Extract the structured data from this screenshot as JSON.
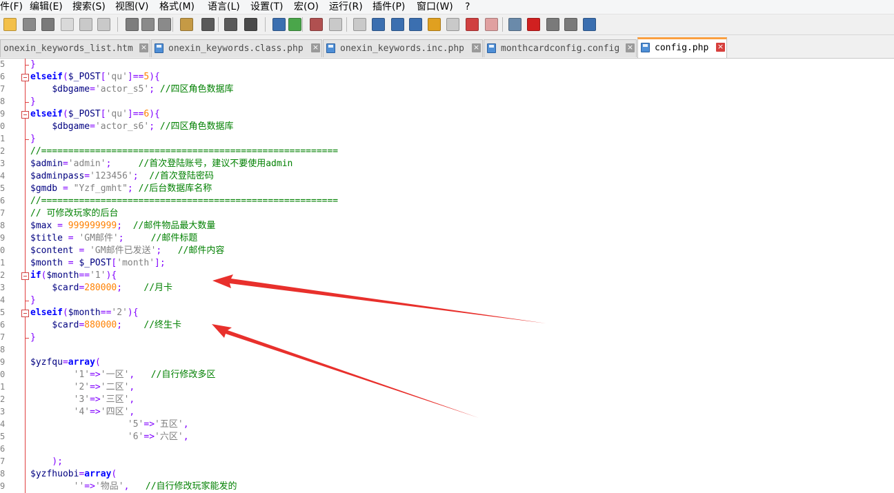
{
  "menu": [
    "件(F)",
    "编辑(E)",
    "搜索(S)",
    "视图(V)",
    "格式(M)",
    "语言(L)",
    "设置(T)",
    "宏(O)",
    "运行(R)",
    "插件(P)",
    "窗口(W)",
    "?"
  ],
  "toolbar": {
    "icons": [
      "new-file-icon",
      "open-file-icon",
      "save-icon",
      "save-all-icon",
      "close-icon",
      "close-all-icon",
      "print-icon",
      "cut-icon",
      "copy-icon",
      "paste-icon",
      "undo-icon",
      "redo-icon",
      "find-icon",
      "replace-icon",
      "zoom-in-icon",
      "zoom-out-icon",
      "sync-vertical-icon",
      "sync-horizontal-icon",
      "word-wrap-icon",
      "show-all-chars-icon",
      "indent-guide-icon",
      "user-language-icon",
      "doc-map-icon",
      "function-list-icon",
      "folder-workspace-icon",
      "monitoring-icon",
      "record-macro-icon",
      "stop-record-icon",
      "play-macro-icon",
      "run-macro-multiple-icon",
      "save-macro-icon"
    ]
  },
  "tabs": [
    {
      "label": "onexin_keywords_list.htm",
      "active": false
    },
    {
      "label": "onexin_keywords.class.php",
      "active": false
    },
    {
      "label": "onexin_keywords.inc.php",
      "active": false
    },
    {
      "label": "monthcardconfig.config",
      "active": false
    },
    {
      "label": "config.php",
      "active": true
    }
  ],
  "editor": {
    "line_numbers": [
      "5",
      "6",
      "7",
      "8",
      "9",
      "0",
      "1",
      "2",
      "3",
      "4",
      "5",
      "6",
      "7",
      "8",
      "9",
      "0",
      "1",
      "2",
      "3",
      "4",
      "5",
      "6",
      "7",
      "8",
      "9",
      "0",
      "1",
      "2",
      "3",
      "4",
      "5",
      "6",
      "7",
      "8",
      "9"
    ],
    "lines": [
      [
        {
          "t": "}",
          "c": "op"
        }
      ],
      [
        {
          "t": "elseif",
          "c": "kw"
        },
        {
          "t": "(",
          "c": "op"
        },
        {
          "t": "$_POST",
          "c": "var"
        },
        {
          "t": "[",
          "c": "op"
        },
        {
          "t": "'qu'",
          "c": "str"
        },
        {
          "t": "]==",
          "c": "op"
        },
        {
          "t": "5",
          "c": "num"
        },
        {
          "t": "){",
          "c": "op"
        }
      ],
      [
        {
          "t": "    ",
          "c": ""
        },
        {
          "t": "$dbgame",
          "c": "var"
        },
        {
          "t": "=",
          "c": "op"
        },
        {
          "t": "'actor_s5'",
          "c": "str"
        },
        {
          "t": "; ",
          "c": "op"
        },
        {
          "t": "//四区角色数据库",
          "c": "cm"
        }
      ],
      [
        {
          "t": "}",
          "c": "op"
        }
      ],
      [
        {
          "t": "elseif",
          "c": "kw"
        },
        {
          "t": "(",
          "c": "op"
        },
        {
          "t": "$_POST",
          "c": "var"
        },
        {
          "t": "[",
          "c": "op"
        },
        {
          "t": "'qu'",
          "c": "str"
        },
        {
          "t": "]==",
          "c": "op"
        },
        {
          "t": "6",
          "c": "num"
        },
        {
          "t": "){",
          "c": "op"
        }
      ],
      [
        {
          "t": "    ",
          "c": ""
        },
        {
          "t": "$dbgame",
          "c": "var"
        },
        {
          "t": "=",
          "c": "op"
        },
        {
          "t": "'actor_s6'",
          "c": "str"
        },
        {
          "t": "; ",
          "c": "op"
        },
        {
          "t": "//四区角色数据库",
          "c": "cm"
        }
      ],
      [
        {
          "t": "}",
          "c": "op"
        }
      ],
      [
        {
          "t": "//=======================================================",
          "c": "cm"
        }
      ],
      [
        {
          "t": "$admin",
          "c": "var"
        },
        {
          "t": "=",
          "c": "op"
        },
        {
          "t": "'admin'",
          "c": "str"
        },
        {
          "t": ";     ",
          "c": "op"
        },
        {
          "t": "//首次登陆账号，建议不要使用admin",
          "c": "cm"
        }
      ],
      [
        {
          "t": "$adminpass",
          "c": "var"
        },
        {
          "t": "=",
          "c": "op"
        },
        {
          "t": "'123456'",
          "c": "str"
        },
        {
          "t": ";  ",
          "c": "op"
        },
        {
          "t": "//首次登陆密码",
          "c": "cm"
        }
      ],
      [
        {
          "t": "$gmdb",
          "c": "var"
        },
        {
          "t": " = ",
          "c": "op"
        },
        {
          "t": "\"Yzf_gmht\"",
          "c": "str"
        },
        {
          "t": "; ",
          "c": "op"
        },
        {
          "t": "//后台数据库名称",
          "c": "cm"
        }
      ],
      [
        {
          "t": "//=======================================================",
          "c": "cm"
        }
      ],
      [
        {
          "t": "// 可修改玩家的后台",
          "c": "cm"
        }
      ],
      [
        {
          "t": "$max",
          "c": "var"
        },
        {
          "t": " = ",
          "c": "op"
        },
        {
          "t": "999999999",
          "c": "num"
        },
        {
          "t": ";  ",
          "c": "op"
        },
        {
          "t": "//邮件物品最大数量",
          "c": "cm"
        }
      ],
      [
        {
          "t": "$title",
          "c": "var"
        },
        {
          "t": " = ",
          "c": "op"
        },
        {
          "t": "'GM邮件'",
          "c": "str"
        },
        {
          "t": ";     ",
          "c": "op"
        },
        {
          "t": "//邮件标题",
          "c": "cm"
        }
      ],
      [
        {
          "t": "$content",
          "c": "var"
        },
        {
          "t": " = ",
          "c": "op"
        },
        {
          "t": "'GM邮件已发送'",
          "c": "str"
        },
        {
          "t": ";   ",
          "c": "op"
        },
        {
          "t": "//邮件内容",
          "c": "cm"
        }
      ],
      [
        {
          "t": "$month",
          "c": "var"
        },
        {
          "t": " = ",
          "c": "op"
        },
        {
          "t": "$_POST",
          "c": "var"
        },
        {
          "t": "[",
          "c": "op"
        },
        {
          "t": "'month'",
          "c": "str"
        },
        {
          "t": "];",
          "c": "op"
        }
      ],
      [
        {
          "t": "if",
          "c": "kw"
        },
        {
          "t": "(",
          "c": "op"
        },
        {
          "t": "$month",
          "c": "var"
        },
        {
          "t": "==",
          "c": "op"
        },
        {
          "t": "'1'",
          "c": "str"
        },
        {
          "t": "){",
          "c": "op"
        }
      ],
      [
        {
          "t": "    ",
          "c": ""
        },
        {
          "t": "$card",
          "c": "var"
        },
        {
          "t": "=",
          "c": "op"
        },
        {
          "t": "280000",
          "c": "num"
        },
        {
          "t": ";    ",
          "c": "op"
        },
        {
          "t": "//月卡",
          "c": "cm"
        }
      ],
      [
        {
          "t": "}",
          "c": "op"
        }
      ],
      [
        {
          "t": "elseif",
          "c": "kw"
        },
        {
          "t": "(",
          "c": "op"
        },
        {
          "t": "$month",
          "c": "var"
        },
        {
          "t": "==",
          "c": "op"
        },
        {
          "t": "'2'",
          "c": "str"
        },
        {
          "t": "){",
          "c": "op"
        }
      ],
      [
        {
          "t": "    ",
          "c": ""
        },
        {
          "t": "$card",
          "c": "var"
        },
        {
          "t": "=",
          "c": "op"
        },
        {
          "t": "880000",
          "c": "num"
        },
        {
          "t": ";    ",
          "c": "op"
        },
        {
          "t": "//终生卡",
          "c": "cm"
        }
      ],
      [
        {
          "t": "}",
          "c": "op"
        }
      ],
      [],
      [
        {
          "t": "$yzfqu",
          "c": "var"
        },
        {
          "t": "=",
          "c": "op"
        },
        {
          "t": "array",
          "c": "kw"
        },
        {
          "t": "(",
          "c": "op"
        }
      ],
      [
        {
          "t": "        ",
          "c": ""
        },
        {
          "t": "'1'",
          "c": "str"
        },
        {
          "t": "=>",
          "c": "op"
        },
        {
          "t": "'一区'",
          "c": "str"
        },
        {
          "t": ",   ",
          "c": "op"
        },
        {
          "t": "//自行修改多区",
          "c": "cm"
        }
      ],
      [
        {
          "t": "        ",
          "c": ""
        },
        {
          "t": "'2'",
          "c": "str"
        },
        {
          "t": "=>",
          "c": "op"
        },
        {
          "t": "'二区'",
          "c": "str"
        },
        {
          "t": ",",
          "c": "op"
        }
      ],
      [
        {
          "t": "        ",
          "c": ""
        },
        {
          "t": "'3'",
          "c": "str"
        },
        {
          "t": "=>",
          "c": "op"
        },
        {
          "t": "'三区'",
          "c": "str"
        },
        {
          "t": ",",
          "c": "op"
        }
      ],
      [
        {
          "t": "        ",
          "c": ""
        },
        {
          "t": "'4'",
          "c": "str"
        },
        {
          "t": "=>",
          "c": "op"
        },
        {
          "t": "'四区'",
          "c": "str"
        },
        {
          "t": ",",
          "c": "op"
        }
      ],
      [
        {
          "t": "                  ",
          "c": ""
        },
        {
          "t": "'5'",
          "c": "str"
        },
        {
          "t": "=>",
          "c": "op"
        },
        {
          "t": "'五区'",
          "c": "str"
        },
        {
          "t": ",",
          "c": "op"
        }
      ],
      [
        {
          "t": "                  ",
          "c": ""
        },
        {
          "t": "'6'",
          "c": "str"
        },
        {
          "t": "=>",
          "c": "op"
        },
        {
          "t": "'六区'",
          "c": "str"
        },
        {
          "t": ",",
          "c": "op"
        }
      ],
      [],
      [
        {
          "t": "    ",
          "c": ""
        },
        {
          "t": ");",
          "c": "op"
        }
      ],
      [
        {
          "t": "$yzfhuobi",
          "c": "var"
        },
        {
          "t": "=",
          "c": "op"
        },
        {
          "t": "array",
          "c": "kw"
        },
        {
          "t": "(",
          "c": "op"
        }
      ],
      [
        {
          "t": "        ",
          "c": ""
        },
        {
          "t": "''",
          "c": "str"
        },
        {
          "t": "=>",
          "c": "op"
        },
        {
          "t": "'物品'",
          "c": "str"
        },
        {
          "t": ",   ",
          "c": "op"
        },
        {
          "t": "//自行修改玩家能发的",
          "c": "cm"
        }
      ]
    ]
  },
  "annotations": {
    "arrow_color": "#e8302c",
    "arrows": [
      "red-arrow-pointing-to-month-card-line",
      "red-arrow-pointing-to-lifetime-card-line"
    ]
  }
}
